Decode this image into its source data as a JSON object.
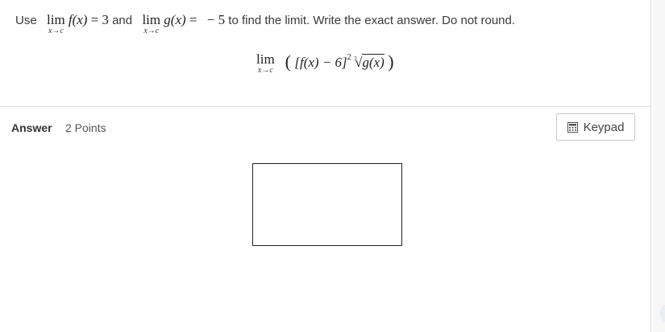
{
  "question": {
    "prefix": "Use",
    "lim_word": "lim",
    "sub": "x→c",
    "f_of_x": "f(x)",
    "equals": "=",
    "f_value": "3",
    "and": "and",
    "g_of_x": "g(x)",
    "g_value": "− 5",
    "suffix": "to find the limit. Write the exact answer. Do not round.",
    "expression": {
      "lim_word": "lim",
      "sub": "x→c",
      "open": "(",
      "bracket_body": "[f(x) − 6]",
      "exponent": "2",
      "root_index": "3",
      "root_body": "g(x)",
      "close": ")"
    }
  },
  "answer": {
    "label": "Answer",
    "points": "2 Points",
    "keypad_label": "Keypad",
    "input_value": ""
  },
  "icons": {
    "keypad": "calculator-icon"
  }
}
